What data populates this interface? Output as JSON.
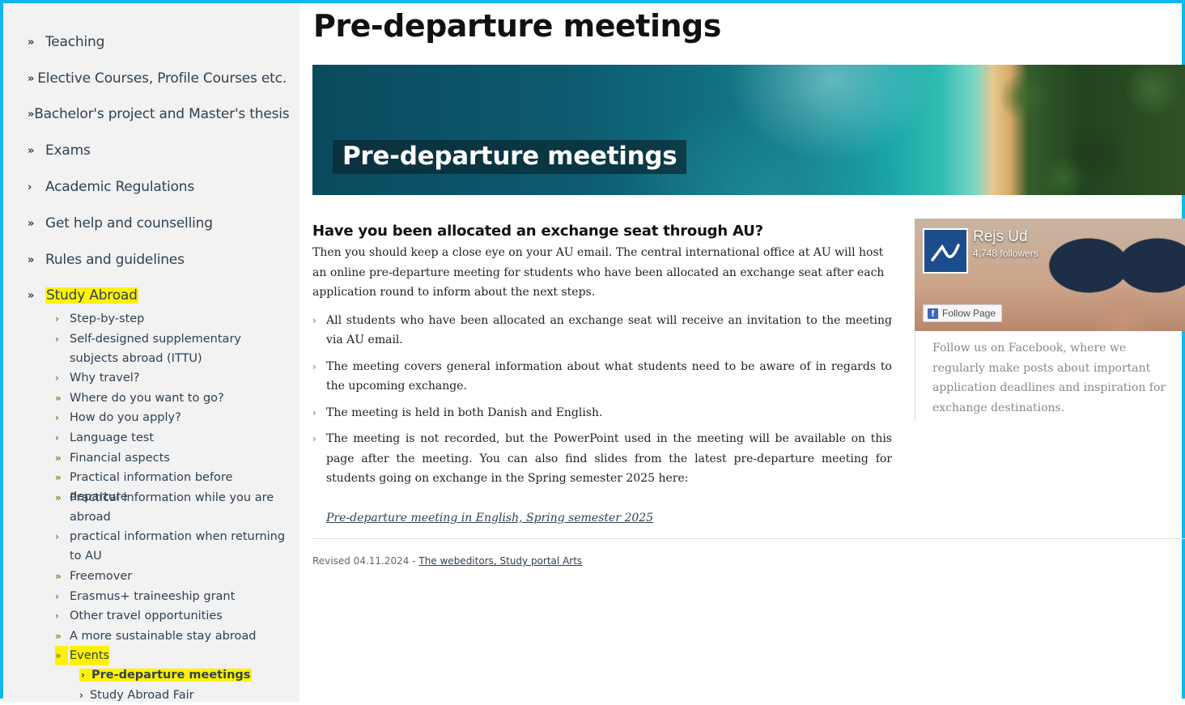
{
  "sidebar": {
    "top_items": [
      {
        "label": "Teaching",
        "marker": "»"
      },
      {
        "label": "Elective Courses, Profile Courses etc.",
        "marker": "»"
      },
      {
        "label": "Bachelor's project and Master's thesis",
        "marker": "»"
      },
      {
        "label": "Exams",
        "marker": "»"
      },
      {
        "label": "Academic Regulations",
        "marker": "›"
      },
      {
        "label": "Get help and counselling",
        "marker": "»"
      },
      {
        "label": "Rules and guidelines",
        "marker": "»"
      },
      {
        "label": "Study Abroad",
        "marker": "»"
      }
    ],
    "sub_items": [
      {
        "label": "Step-by-step",
        "marker": "›"
      },
      {
        "label": "Self-designed supplementary subjects abroad (ITTU)",
        "marker": "›"
      },
      {
        "label": "Why travel?",
        "marker": "›"
      },
      {
        "label": "Where do you want to go?",
        "marker": "»"
      },
      {
        "label": "How do you apply?",
        "marker": "›"
      },
      {
        "label": "Language test",
        "marker": "›"
      },
      {
        "label": "Financial aspects",
        "marker": "»"
      },
      {
        "label": "Practical information before departure",
        "marker": "»"
      },
      {
        "label": "Practical information while you are abroad",
        "marker": "»"
      },
      {
        "label": "practical information when returning to AU",
        "marker": "›"
      },
      {
        "label": "Freemover",
        "marker": "»"
      },
      {
        "label": "Erasmus+ traineeship grant",
        "marker": "›"
      },
      {
        "label": "Other travel opportunities",
        "marker": "›"
      },
      {
        "label": "A more sustainable stay abroad",
        "marker": "»"
      },
      {
        "label": "Events",
        "marker": "»"
      }
    ],
    "event_items": [
      {
        "label": "Pre-departure meetings",
        "marker": "›"
      },
      {
        "label": "Study Abroad Fair",
        "marker": "›"
      }
    ]
  },
  "main": {
    "page_title": "Pre-departure meetings",
    "hero_label": "Pre-departure meetings",
    "heading": "Have you been allocated an exchange seat through AU?",
    "intro": "Then you should keep a close eye on your AU email. The central international office at AU will host an online pre-departure meeting for students who have been allocated an exchange seat after each application round to inform about the next steps.",
    "bullets": [
      "All students who have been allocated an exchange seat will receive an invitation to the meeting via AU email.",
      "The meeting covers general information about what students need to be aware of in regards to the upcoming exchange.",
      "The meeting is held in both Danish and English.",
      "The meeting is not recorded, but the PowerPoint used in the meeting will be available on this page after the meeting. You can also find slides from the latest pre-departure meeting for students going on exchange in the Spring semester 2025 here:"
    ],
    "bullet_marker": "›",
    "doc_link": "Pre-departure meeting in English, Spring semester 2025",
    "revised_text": "Revised 04.11.2024 - ",
    "revised_link": "The webeditors, Study portal Arts"
  },
  "facebook": {
    "page_name": "Rejs Ud",
    "followers": "4,748 followers",
    "follow_button": "Follow Page",
    "description": "Follow us on Facebook, where we regularly make posts about important application deadlines and inspiration for exchange destinations."
  },
  "colors": {
    "frame": "#0fb6ef",
    "highlight": "#fff200",
    "sidebar_bg": "#f2f2f2",
    "nav_text": "#2f4152",
    "sub_marker": "#6b8c1f"
  }
}
